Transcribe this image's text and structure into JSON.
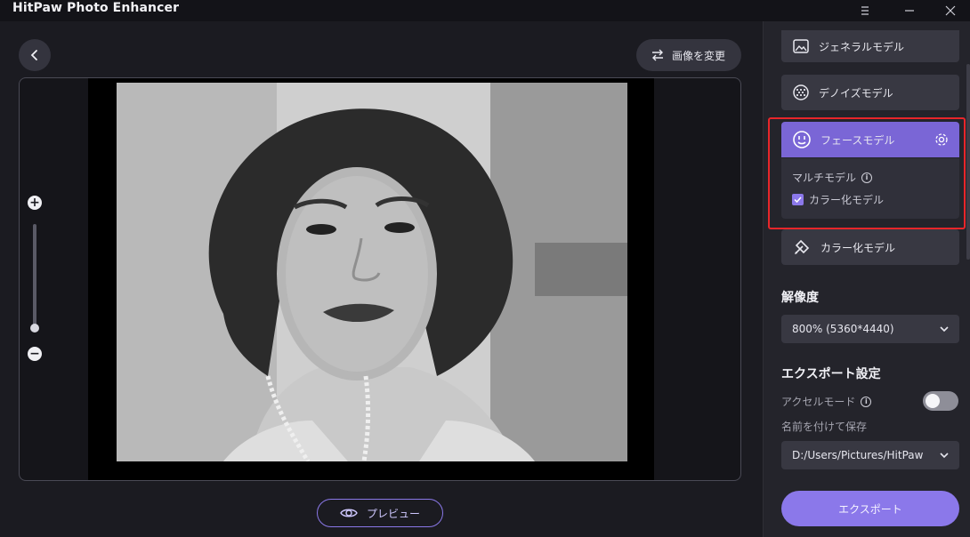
{
  "app": {
    "title": "HitPaw Photo Enhancer"
  },
  "toolbar": {
    "change_image_label": "画像を変更"
  },
  "preview": {
    "label": "プレビュー"
  },
  "zoom": {
    "level": 0.1
  },
  "sidebar": {
    "models": [
      {
        "label": "ジェネラルモデル",
        "icon": "image-icon"
      },
      {
        "label": "デノイズモデル",
        "icon": "denoise-icon"
      },
      {
        "label": "フェースモデル",
        "icon": "face-icon",
        "selected": true
      },
      {
        "label": "カラー化モデル",
        "icon": "colorize-icon"
      }
    ],
    "face_panel": {
      "multi_model_label": "マルチモデル",
      "colorize_checkbox_label": "カラー化モデル",
      "colorize_checked": true
    },
    "resolution": {
      "title": "解像度",
      "value": "800% (5360*4440)"
    },
    "export_settings": {
      "title": "エクスポート設定",
      "accel_label": "アクセルモード",
      "accel_enabled": false,
      "save_as_label": "名前を付けて保存",
      "path": "D:/Users/Pictures/HitPaw"
    },
    "export_button_label": "エクスポート"
  },
  "colors": {
    "accent": "#8b78ea",
    "highlight": "#e8262a"
  }
}
